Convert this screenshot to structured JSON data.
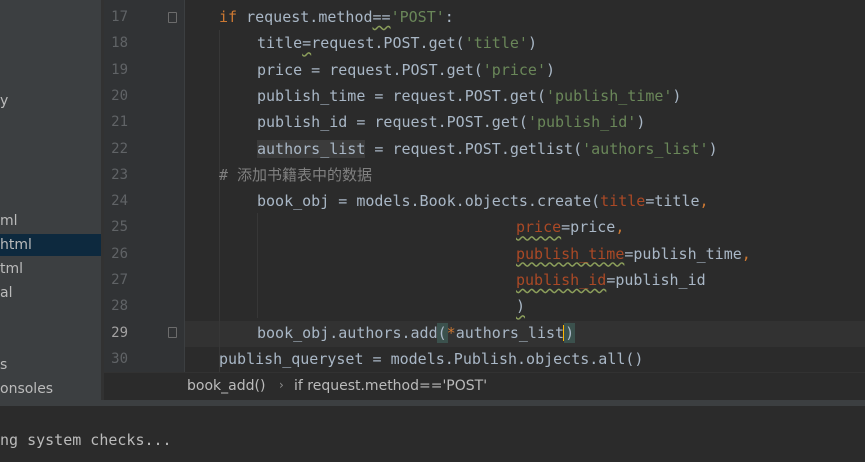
{
  "sidebar": {
    "items": [
      {
        "label": "y",
        "selected": false
      },
      {
        "label": "ml",
        "selected": false
      },
      {
        "label": "html",
        "selected": true
      },
      {
        "label": "tml",
        "selected": false
      },
      {
        "label": "al",
        "selected": false
      },
      {
        "label": "s",
        "selected": false
      },
      {
        "label": "onsoles",
        "selected": false
      }
    ]
  },
  "editor": {
    "current_line": "29",
    "lines": [
      {
        "number": "17",
        "tokens": [
          {
            "t": "if",
            "c": "kw"
          },
          {
            "t": " request.method",
            "c": ""
          },
          {
            "t": "==",
            "c": "squig"
          },
          {
            "t": "'POST'",
            "c": "str"
          },
          {
            "t": ":",
            "c": ""
          }
        ]
      },
      {
        "number": "18",
        "tokens": [
          {
            "t": "title",
            "c": ""
          },
          {
            "t": "=",
            "c": "squig"
          },
          {
            "t": "request.POST.get(",
            "c": ""
          },
          {
            "t": "'title'",
            "c": "str"
          },
          {
            "t": ")",
            "c": ""
          }
        ]
      },
      {
        "number": "19",
        "tokens": [
          {
            "t": "price = request.POST.get(",
            "c": ""
          },
          {
            "t": "'price'",
            "c": "str"
          },
          {
            "t": ")",
            "c": ""
          }
        ]
      },
      {
        "number": "20",
        "tokens": [
          {
            "t": "publish_time = request.POST.get(",
            "c": ""
          },
          {
            "t": "'publish_time'",
            "c": "str"
          },
          {
            "t": ")",
            "c": ""
          }
        ]
      },
      {
        "number": "21",
        "tokens": [
          {
            "t": "publish_id = request.POST.get(",
            "c": ""
          },
          {
            "t": "'publish_id'",
            "c": "str"
          },
          {
            "t": ")",
            "c": ""
          }
        ]
      },
      {
        "number": "22",
        "tokens": [
          {
            "t": "authors_list",
            "c": "hl-var"
          },
          {
            "t": " = request.POST.getlist(",
            "c": ""
          },
          {
            "t": "'authors_list'",
            "c": "str"
          },
          {
            "t": ")",
            "c": ""
          }
        ]
      },
      {
        "number": "23",
        "tokens": [
          {
            "t": "# 添加书籍表中的数据",
            "c": "comment"
          }
        ]
      },
      {
        "number": "24",
        "tokens": [
          {
            "t": "book_obj = models.Book.objects.create(",
            "c": ""
          },
          {
            "t": "title",
            "c": "param"
          },
          {
            "t": "=title",
            "c": ""
          },
          {
            "t": ",",
            "c": "kw"
          }
        ]
      },
      {
        "number": "25",
        "tokens": [
          {
            "t": "price",
            "c": "param squig"
          },
          {
            "t": "=price",
            "c": ""
          },
          {
            "t": ",",
            "c": "kw"
          }
        ]
      },
      {
        "number": "26",
        "tokens": [
          {
            "t": "publish_time",
            "c": "param squig"
          },
          {
            "t": "=publish_time",
            "c": ""
          },
          {
            "t": ",",
            "c": "kw"
          }
        ]
      },
      {
        "number": "27",
        "tokens": [
          {
            "t": "publish_id",
            "c": "param squig"
          },
          {
            "t": "=publish_id",
            "c": ""
          }
        ]
      },
      {
        "number": "28",
        "tokens": [
          {
            "t": ")",
            "c": "squig"
          }
        ]
      },
      {
        "number": "29",
        "tokens": [
          {
            "t": "book_obj.authors.add",
            "c": ""
          },
          {
            "t": "(",
            "c": "brace-match"
          },
          {
            "t": "*",
            "c": "kw"
          },
          {
            "t": "authors_list",
            "c": ""
          },
          {
            "t": "|",
            "c": "cursor"
          },
          {
            "t": ")",
            "c": "brace-match"
          }
        ]
      },
      {
        "number": "30",
        "tokens": [
          {
            "t": "publish_queryset = models.Publish.objects.all()",
            "c": ""
          }
        ]
      }
    ]
  },
  "breadcrumb": {
    "items": [
      "book_add()",
      "if request.method=='POST'"
    ],
    "separator": "›"
  },
  "console": {
    "text": "ng system checks..."
  },
  "colors": {
    "keyword": "#cc7832",
    "string": "#6a8759",
    "parameter": "#aa4926",
    "comment": "#808080",
    "background": "#2b2b2b"
  }
}
